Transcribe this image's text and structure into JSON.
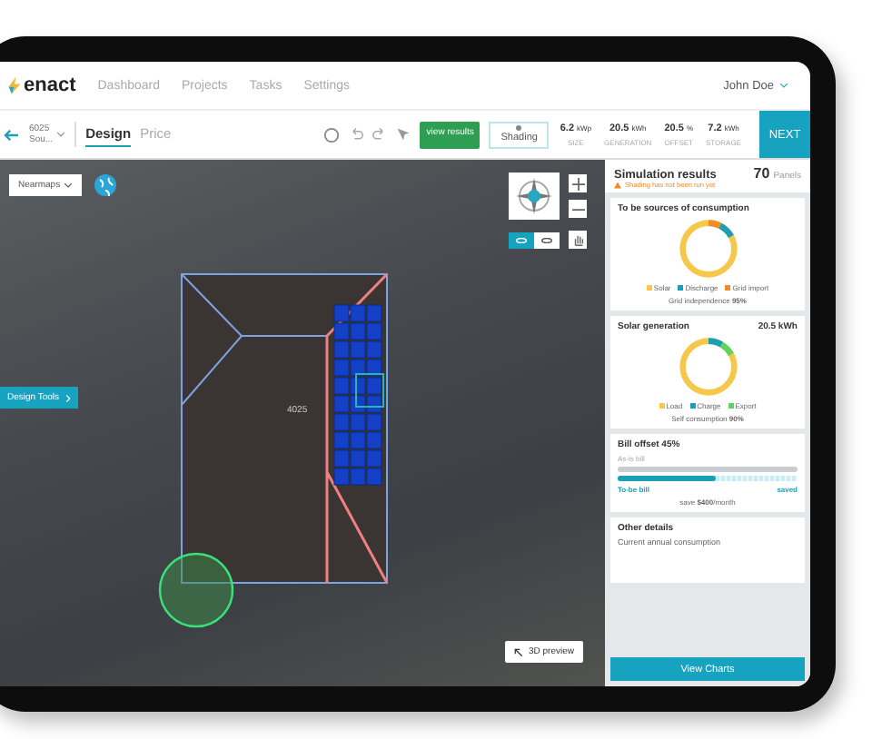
{
  "brand": "enact",
  "nav": [
    {
      "label": "Dashboard"
    },
    {
      "label": "Projects"
    },
    {
      "label": "Tasks"
    },
    {
      "label": "Settings"
    }
  ],
  "user": "John Doe",
  "project": {
    "line1": "6025",
    "line2": "Sou..."
  },
  "tabs": [
    {
      "label": "Design",
      "selected": true
    },
    {
      "label": "Price",
      "selected": false
    }
  ],
  "view_results": "view results",
  "shading": "Shading",
  "stats": [
    {
      "value": "6.2",
      "unit": "kWp",
      "label": "SIZE"
    },
    {
      "value": "20.5",
      "unit": "kWh",
      "label": "GENERATION"
    },
    {
      "value": "20.5",
      "unit": "%",
      "label": "OFFSET"
    },
    {
      "value": "7.2",
      "unit": "kWh",
      "label": "STORAGE"
    }
  ],
  "next": "NEXT",
  "map": {
    "layer": "Nearmaps",
    "design_tools": "Design Tools",
    "roof_label": "4025",
    "preview": "3D preview",
    "view_toggle": [
      {
        "selected": true
      },
      {
        "selected": false
      }
    ]
  },
  "panel": {
    "title": "Simulation results",
    "warning": "Shading has not been run yet",
    "panel_count": "70",
    "panel_unit": "Panels",
    "consumption": {
      "title": "To be sources of consumption",
      "legend": [
        {
          "label": "Solar",
          "color": "#f5c84c"
        },
        {
          "label": "Discharge",
          "color": "#1a9fb5"
        },
        {
          "label": "Grid import",
          "color": "#f28c28"
        }
      ],
      "note": "Grid independence **95%**"
    },
    "generation": {
      "title": "Solar generation",
      "value": "20.5 kWh",
      "legend": [
        {
          "label": "Load",
          "color": "#f5c84c"
        },
        {
          "label": "Charge",
          "color": "#1a9fb5"
        },
        {
          "label": "Export",
          "color": "#5fd35f"
        }
      ],
      "note": "Self consumption **90%**"
    },
    "bill": {
      "title": "Bill offset 45%",
      "as_is": "As-is bill",
      "to_be": "To-be bill",
      "saved": "saved",
      "level": 0.55,
      "note": "save **$400**/month"
    },
    "other": {
      "title": "Other details",
      "line": "Current annual consumption"
    },
    "button": "View Charts"
  }
}
